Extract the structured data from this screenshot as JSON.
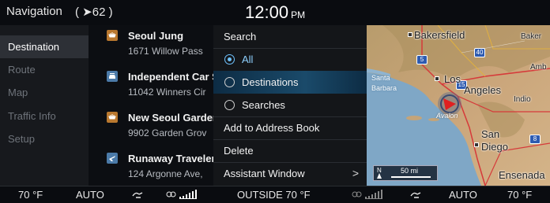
{
  "status_bar": {
    "title": "Navigation",
    "count": "( ➤62 )",
    "time": "12:00",
    "ampm": "PM"
  },
  "left_nav": {
    "items": [
      {
        "label": "Destination",
        "active": true
      },
      {
        "label": "Route"
      },
      {
        "label": "Map"
      },
      {
        "label": "Traffic Info"
      },
      {
        "label": "Setup"
      }
    ]
  },
  "list": {
    "items": [
      {
        "name": "Seoul Jung",
        "address": "1671 Willow Pass",
        "icon": "restaurant-icon"
      },
      {
        "name": "Independent Car S",
        "address": "11042 Winners Cir",
        "icon": "car-service-icon"
      },
      {
        "name": "New Seoul Garden",
        "address": "9902 Garden Grov",
        "icon": "restaurant-icon"
      },
      {
        "name": "Runaway Traveler",
        "address": "124 Argonne Ave,",
        "icon": "travel-icon"
      }
    ]
  },
  "menu": {
    "search_label": "Search",
    "options": [
      {
        "label": "All",
        "checked": true
      },
      {
        "label": "Destinations",
        "checked": false,
        "highlighted": true
      },
      {
        "label": "Searches",
        "checked": false
      }
    ],
    "add_to_address_book": "Add to Address Book",
    "delete": "Delete",
    "assistant_window": "Assistant Window",
    "assistant_chevron": ">"
  },
  "map": {
    "labels": {
      "bakersfield": "Bakersfield",
      "baker": "Baker",
      "amb": "Amb",
      "los": "Los",
      "angeles": "Angeles",
      "santa": "Santa",
      "barbara": "Barbara",
      "indio": "Indio",
      "avalon": "Avalon",
      "san": "San",
      "diego": "Diego",
      "ensenada": "Ensenada"
    },
    "highways": [
      "5",
      "40",
      "15",
      "8"
    ],
    "scale": {
      "north": "N",
      "distance": "50 mi"
    }
  },
  "climate_bar": {
    "left_temp": "70 °F",
    "left_mode": "AUTO",
    "outside": "OUTSIDE  70 °F",
    "right_mode": "AUTO",
    "right_temp": "70 °F"
  }
}
